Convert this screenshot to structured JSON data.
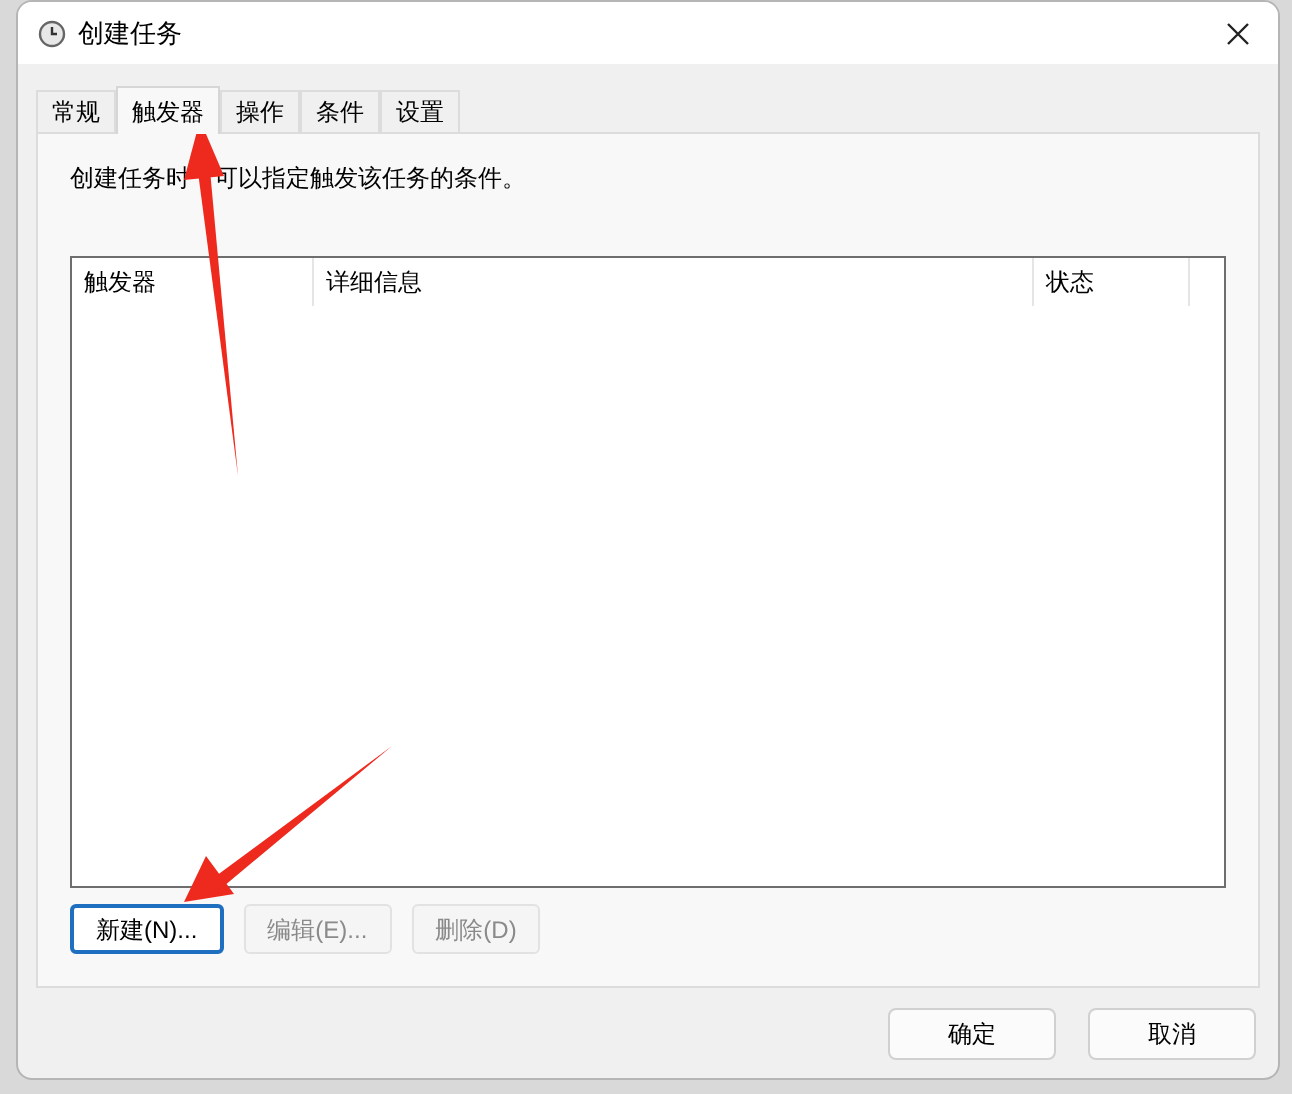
{
  "window": {
    "title": "创建任务"
  },
  "tabs": [
    {
      "label": "常规",
      "selected": false
    },
    {
      "label": "触发器",
      "selected": true
    },
    {
      "label": "操作",
      "selected": false
    },
    {
      "label": "条件",
      "selected": false
    },
    {
      "label": "设置",
      "selected": false
    }
  ],
  "description": [
    "创建任务时",
    "可以指定触发该任务的条件。"
  ],
  "table": {
    "columns": [
      "触发器",
      "详细信息",
      "状态"
    ]
  },
  "actions": [
    {
      "label": "新建(N)...",
      "disabled": false,
      "focused": true
    },
    {
      "label": "编辑(E)...",
      "disabled": true,
      "focused": false
    },
    {
      "label": "删除(D)",
      "disabled": true,
      "focused": false
    }
  ],
  "buttons": [
    "确定",
    "取消"
  ]
}
